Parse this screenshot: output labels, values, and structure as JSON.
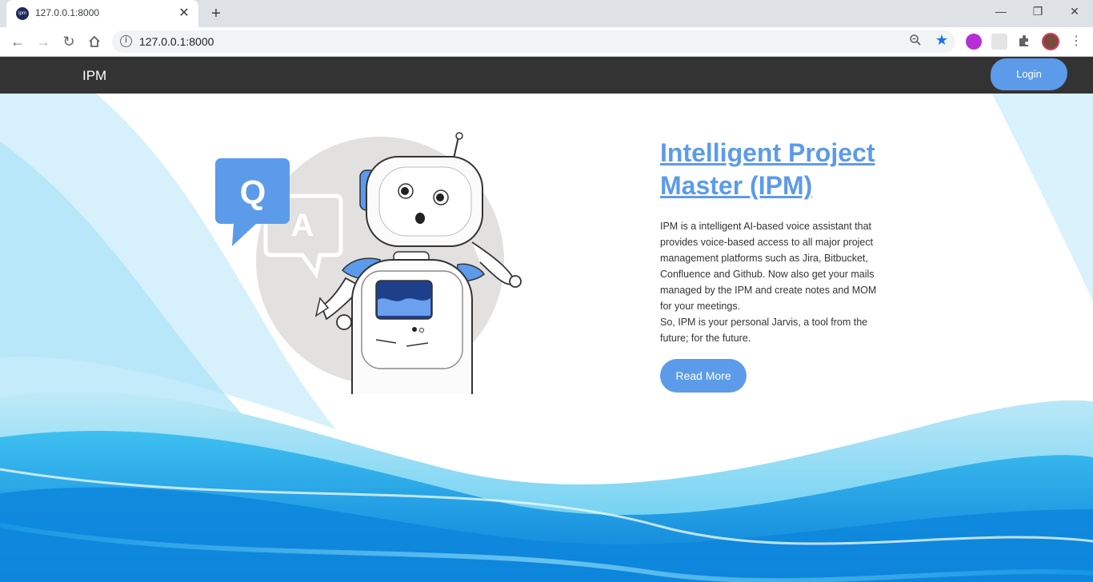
{
  "browser": {
    "tab_title": "127.0.0.1:8000",
    "tab_favicon_text": "ipm",
    "url": "127.0.0.1:8000"
  },
  "navbar": {
    "brand": "IPM",
    "login_label": "Login"
  },
  "hero": {
    "title": "Intelligent Project Master (IPM)",
    "description_1": "IPM is a intelligent AI-based voice assistant that provides voice-based access to all major project management platforms such as Jira, Bitbucket, Confluence and Github. Now also get your mails managed by the IPM and create notes and MOM for your meetings.",
    "description_2": "So, IPM is your personal Jarvis, a tool from the future; for the future.",
    "read_more_label": "Read More"
  },
  "illustration": {
    "q_letter": "Q",
    "a_letter": "A"
  },
  "colors": {
    "accent": "#5c9bea",
    "navbar": "#333333",
    "wave": "#1aa3e8"
  }
}
